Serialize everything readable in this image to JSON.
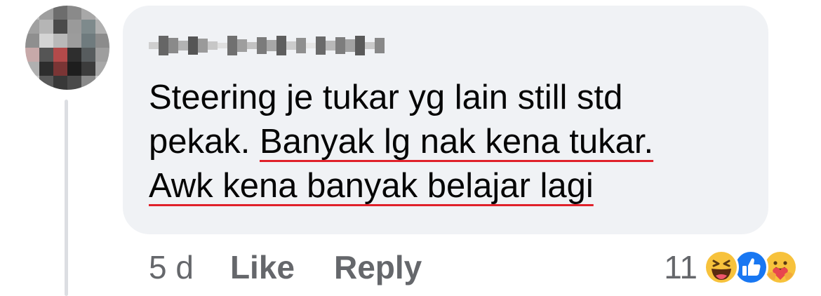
{
  "comment": {
    "line1": "Steering je tukar yg lain still std",
    "line2_plain": "pekak. ",
    "line2_underlined": "Banyak lg nak kena tukar.",
    "line3_underlined": "Awk kena banyak belajar lagi"
  },
  "actions": {
    "timestamp": "5 d",
    "like_label": "Like",
    "reply_label": "Reply"
  },
  "reactions": {
    "count": "11",
    "icons": [
      "haha-icon",
      "like-reaction-icon",
      "care-icon"
    ]
  },
  "colors": {
    "bubble": "#f0f2f5",
    "text": "#050505",
    "muted": "#65676b",
    "underline": "#e0212a",
    "like_blue": "#1877f2"
  }
}
